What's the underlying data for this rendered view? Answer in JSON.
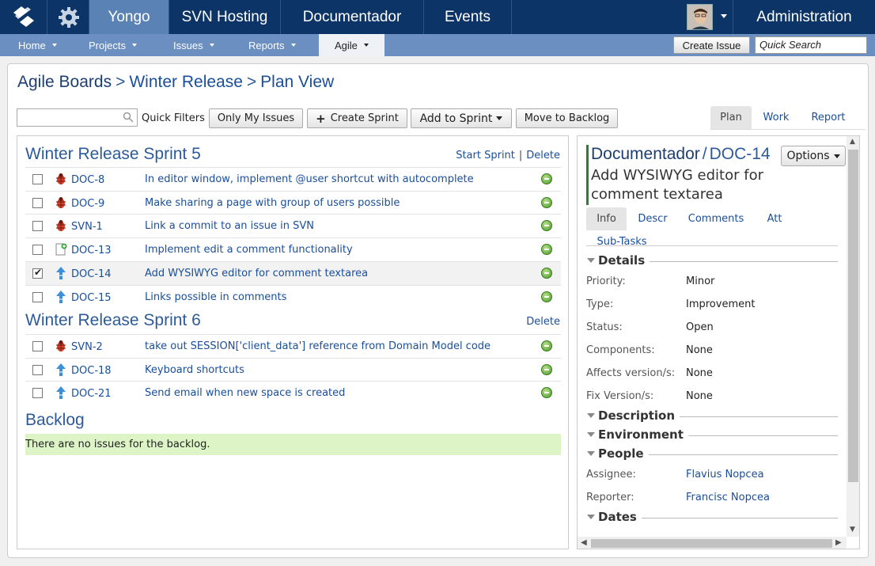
{
  "topnav": {
    "items": [
      "Yongo",
      "SVN Hosting",
      "Documentador",
      "Events"
    ],
    "admin": "Administration"
  },
  "subnav": {
    "items": [
      "Home",
      "Projects",
      "Issues",
      "Reports",
      "Agile"
    ],
    "create_issue": "Create Issue",
    "quick_search_placeholder": "Quick Search"
  },
  "breadcrumb": [
    "Agile Boards",
    "Winter Release",
    "Plan View"
  ],
  "toolbar": {
    "quick_filters": "Quick Filters",
    "only_my_issues": "Only My Issues",
    "create_sprint": "Create Sprint",
    "add_to_sprint": "Add to Sprint",
    "move_to_backlog": "Move to Backlog"
  },
  "view_tabs": [
    "Plan",
    "Work",
    "Report"
  ],
  "sprints": [
    {
      "title": "Winter Release Sprint 5",
      "start": "Start Sprint",
      "delete": "Delete",
      "issues": [
        {
          "type": "bug",
          "key": "DOC-8",
          "summary": "In editor window, implement @user shortcut with autocomplete",
          "checked": false
        },
        {
          "type": "bug",
          "key": "DOC-9",
          "summary": "Make sharing a page with group of users possible",
          "checked": false
        },
        {
          "type": "bug",
          "key": "SVN-1",
          "summary": "Link a commit to an issue in SVN",
          "checked": false
        },
        {
          "type": "new-feature",
          "key": "DOC-13",
          "summary": "Implement edit a comment functionality",
          "checked": false
        },
        {
          "type": "improvement",
          "key": "DOC-14",
          "summary": "Add WYSIWYG editor for comment textarea",
          "checked": true
        },
        {
          "type": "improvement",
          "key": "DOC-15",
          "summary": "Links possible in comments",
          "checked": false
        }
      ]
    },
    {
      "title": "Winter Release Sprint 6",
      "delete": "Delete",
      "issues": [
        {
          "type": "bug",
          "key": "SVN-2",
          "summary": "take out SESSION['client_data'] reference from Domain Model code",
          "checked": false
        },
        {
          "type": "improvement",
          "key": "DOC-18",
          "summary": "Keyboard shortcuts",
          "checked": false
        },
        {
          "type": "improvement",
          "key": "DOC-21",
          "summary": "Send email when new space is created",
          "checked": false
        }
      ]
    }
  ],
  "backlog": {
    "title": "Backlog",
    "empty": "There are no issues for the backlog."
  },
  "detail": {
    "project": "Documentador",
    "key": "DOC-14",
    "summary": "Add WYSIWYG editor for comment textarea",
    "options": "Options",
    "tabs": [
      "Info",
      "Descr",
      "Comments",
      "Att",
      "Sub-Tasks"
    ],
    "details_title": "Details",
    "fields": [
      {
        "label": "Priority:",
        "value": "Minor"
      },
      {
        "label": "Type:",
        "value": "Improvement"
      },
      {
        "label": "Status:",
        "value": "Open"
      },
      {
        "label": "Components:",
        "value": "None"
      },
      {
        "label": "Affects version/s:",
        "value": "None"
      },
      {
        "label": "Fix Version/s:",
        "value": "None"
      }
    ],
    "description_title": "Description",
    "environment_title": "Environment",
    "people_title": "People",
    "people": [
      {
        "label": "Assignee:",
        "value": "Flavius Nopcea"
      },
      {
        "label": "Reporter:",
        "value": "Francisc Nopcea"
      }
    ],
    "dates_title": "Dates"
  },
  "colors": {
    "topbar": "#0d3466",
    "active_nav": "#5b82b4",
    "subbar": "#6a8fc0",
    "link": "#1a4e9a",
    "backlog_empty": "#ddf5c6"
  }
}
